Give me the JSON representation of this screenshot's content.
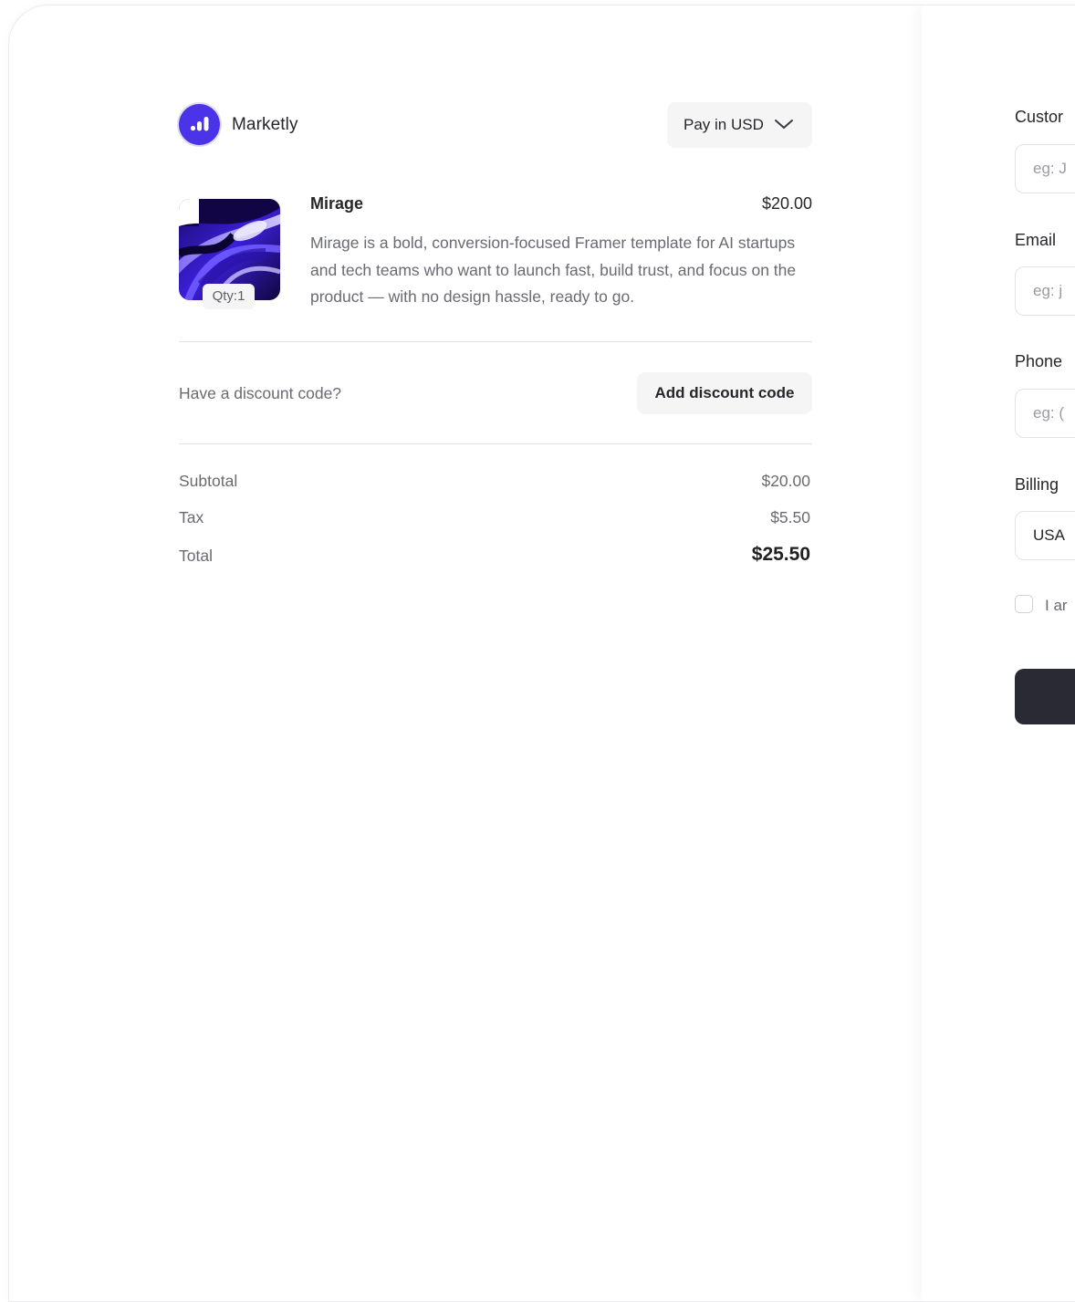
{
  "brand": {
    "name": "Marketly"
  },
  "currency": {
    "label": "Pay in USD",
    "icon": "chevron-down-icon"
  },
  "product": {
    "name": "Mirage",
    "price": "$20.00",
    "qty_label": "Qty:1",
    "description": "Mirage is a bold, conversion-focused Framer template for AI startups and tech teams who want to launch fast, build trust, and focus on the product — with no design hassle, ready to go."
  },
  "discount": {
    "question": "Have a discount code?",
    "button_label": "Add discount code"
  },
  "summary": {
    "subtotal_label": "Subtotal",
    "subtotal_value": "$20.00",
    "tax_label": "Tax",
    "tax_value": "$5.50",
    "total_label": "Total",
    "total_value": "$25.50"
  },
  "form": {
    "customer_label": "Custor",
    "customer_placeholder": "eg: J",
    "email_label": "Email",
    "email_placeholder": "eg: j",
    "phone_label": "Phone",
    "phone_placeholder": "eg: (",
    "billing_label": "Billing",
    "billing_value": "USA",
    "checkbox_label": "I ar"
  },
  "colors": {
    "brand": "#4a33e8",
    "submit": "#2a2a35"
  }
}
